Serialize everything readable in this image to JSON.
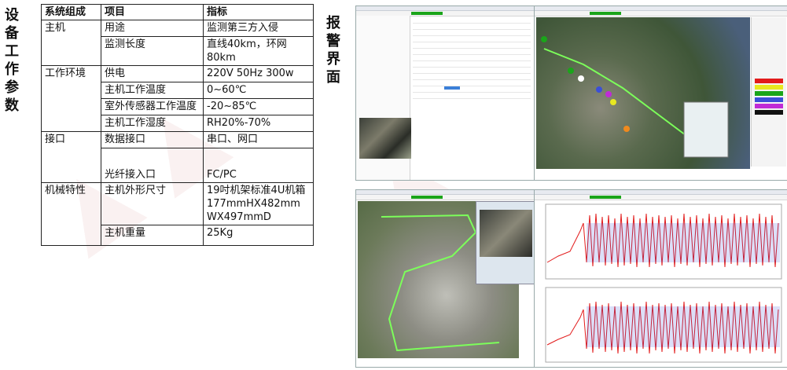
{
  "params_title": "设备工作参数",
  "alarm_title": "报警界面",
  "table": {
    "headers": [
      "系统组成",
      "项目",
      "指标"
    ],
    "rows": [
      [
        "主机",
        "用途",
        "监测第三方入侵"
      ],
      [
        "",
        "监测长度",
        "直线40km，环网80km"
      ],
      [
        "工作环境",
        "供电",
        "220V 50Hz 300w"
      ],
      [
        "",
        "主机工作温度",
        "0~60℃"
      ],
      [
        "",
        "室外传感器工作温度",
        "-20~85℃"
      ],
      [
        "",
        "主机工作湿度",
        "RH20%-70%"
      ],
      [
        "接口",
        "数据接口",
        "串口、网口"
      ],
      [
        "",
        "光纤接入口",
        "FC/PC"
      ],
      [
        "机械特性",
        "主机外形尺寸",
        "19吋机架标准4U机箱177mmHX482mmWX497mmD"
      ],
      [
        "",
        "主机重量",
        "25Kg"
      ]
    ]
  },
  "colors": {
    "map_green": "#4a6a3c",
    "route_green": "#7cff5a",
    "signal_red": "#e21b1b",
    "signal_blue": "#3b4fd8",
    "status_green": "#1aa51a"
  }
}
